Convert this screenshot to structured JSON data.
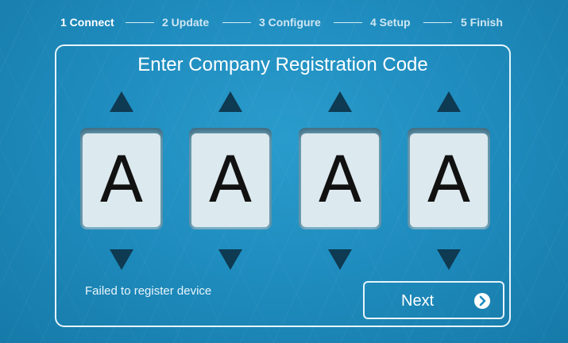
{
  "steps": [
    {
      "label": "1 Connect",
      "active": true
    },
    {
      "label": "2 Update",
      "active": false
    },
    {
      "label": "3 Configure",
      "active": false
    },
    {
      "label": "4 Setup",
      "active": false
    },
    {
      "label": "5 Finish",
      "active": false
    }
  ],
  "dialog": {
    "title": "Enter Company Registration Code",
    "code_chars": [
      "A",
      "A",
      "A",
      "A"
    ],
    "status_text": "Failed to register device",
    "next_label": "Next",
    "next_icon": "chevron-right-circle-icon"
  },
  "colors": {
    "background": "#1f8dbf",
    "arrow": "#0e3a52",
    "digit_bg": "#dce9ee",
    "text": "#ffffff"
  }
}
